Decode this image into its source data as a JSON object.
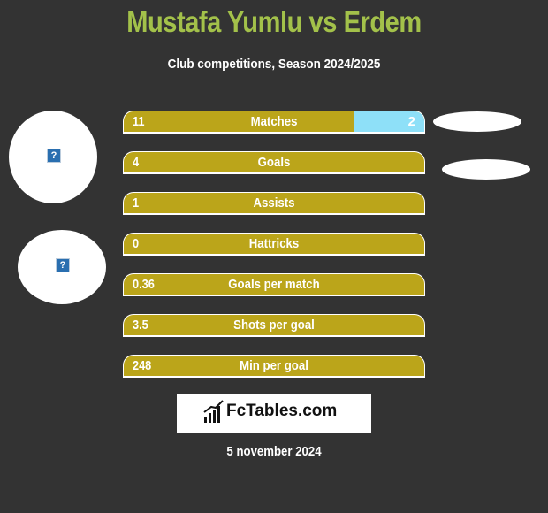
{
  "header": {
    "title": "Mustafa Yumlu vs Erdem",
    "subtitle": "Club competitions, Season 2024/2025"
  },
  "players": {
    "left_avatar_icon": "?",
    "right_avatar_icon": "?"
  },
  "colors": {
    "title": "#a3c14a",
    "left_bar": "#bba51a",
    "right_bar": "#8ee0f8",
    "background": "#333333"
  },
  "stats": [
    {
      "label": "Matches",
      "left": "11",
      "right": "2",
      "right_share": 0.2326
    },
    {
      "label": "Goals",
      "left": "4",
      "right": "",
      "right_share": 0
    },
    {
      "label": "Assists",
      "left": "1",
      "right": "",
      "right_share": 0
    },
    {
      "label": "Hattricks",
      "left": "0",
      "right": "",
      "right_share": 0
    },
    {
      "label": "Goals per match",
      "left": "0.36",
      "right": "",
      "right_share": 0
    },
    {
      "label": "Shots per goal",
      "left": "3.5",
      "right": "",
      "right_share": 0
    },
    {
      "label": "Min per goal",
      "left": "248",
      "right": "",
      "right_share": 0
    }
  ],
  "footer": {
    "logo_text": "FcTables.com",
    "date": "5 november 2024"
  }
}
